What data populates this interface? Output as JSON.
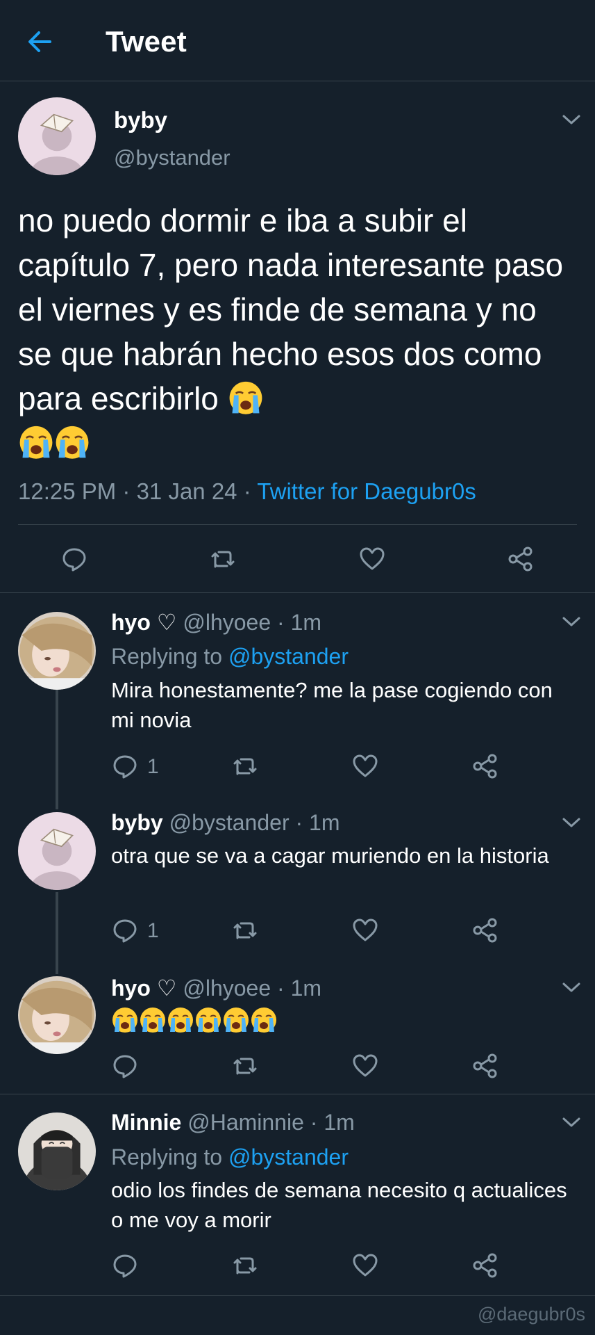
{
  "header": {
    "title": "Tweet",
    "back_icon": "arrow-left-icon"
  },
  "colors": {
    "background": "#15202b",
    "accent": "#1da1f2",
    "muted": "#8899a6",
    "divider": "#38444d"
  },
  "main_tweet": {
    "name": "byby",
    "handle": "@bystander",
    "text": "no puedo dormir e iba a subir el capítulo 7, pero nada interesante paso el viernes y es finde de semana y no se que habrán hecho esos dos como para escribirlo",
    "emojis": [
      "loudly-crying-face",
      "loudly-crying-face",
      "loudly-crying-face"
    ],
    "time": "12:25 PM",
    "date": "31 Jan 24",
    "source": "Twitter for Daegubr0s"
  },
  "replies": [
    {
      "name": "hyo ♡",
      "handle": "@lhyoee",
      "time": "1m",
      "replying_label": "Replying to",
      "replying_to": "@bystander",
      "text": "Mira honestamente? me la pase cogiendo con mi novia",
      "reply_count": "1"
    },
    {
      "name": "byby",
      "handle": "@bystander",
      "time": "1m",
      "text": "otra que se va a cagar muriendo en la historia",
      "reply_count": "1"
    },
    {
      "name": "hyo ♡",
      "handle": "@lhyoee",
      "time": "1m",
      "emojis": [
        "loudly-crying-face",
        "loudly-crying-face",
        "loudly-crying-face",
        "loudly-crying-face",
        "loudly-crying-face",
        "loudly-crying-face"
      ]
    },
    {
      "name": "Minnie",
      "handle": "@Haminnie",
      "time": "1m",
      "replying_label": "Replying to",
      "replying_to": "@bystander",
      "text": "odio los findes de semana necesito q actualices o me voy a morir"
    }
  ],
  "sep": " · ",
  "watermark": "@daegubr0s"
}
